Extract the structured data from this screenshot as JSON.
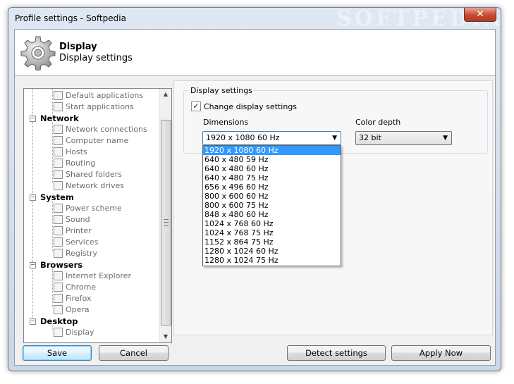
{
  "window": {
    "title": "Profile settings - Softpedia",
    "watermark": "SOFTPEDIA",
    "close_glyph": "✕"
  },
  "header": {
    "title": "Display",
    "subtitle": "Display settings",
    "icon": "gear-icon"
  },
  "tree": {
    "categories": [
      {
        "label": "",
        "children": [
          "Default applications",
          "Start applications"
        ]
      },
      {
        "label": "Network",
        "children": [
          "Network connections",
          "Computer name",
          "Hosts",
          "Routing",
          "Shared folders",
          "Network drives"
        ]
      },
      {
        "label": "System",
        "children": [
          "Power scheme",
          "Sound",
          "Printer",
          "Services",
          "Registry"
        ]
      },
      {
        "label": "Browsers",
        "children": [
          "Internet Explorer",
          "Chrome",
          "Firefox",
          "Opera"
        ]
      },
      {
        "label": "Desktop",
        "children": [
          "Display"
        ]
      }
    ]
  },
  "display_settings": {
    "group_label": "Display settings",
    "change_label": "Change display settings",
    "change_checked": true,
    "dimensions_label": "Dimensions",
    "dimensions_value": "1920 x 1080 60 Hz",
    "color_depth_label": "Color depth",
    "color_depth_value": "32 bit",
    "dimension_options": [
      "1920 x 1080 60 Hz",
      "640 x 480 59 Hz",
      "640 x 480 60 Hz",
      "640 x 480 75 Hz",
      "656 x 496 60 Hz",
      "800 x 600 60 Hz",
      "800 x 600 75 Hz",
      "848 x 480 60 Hz",
      "1024 x 768 60 Hz",
      "1024 x 768 75 Hz",
      "1152 x 864 75 Hz",
      "1280 x 1024 60 Hz",
      "1280 x 1024 75 Hz"
    ],
    "selected_option": "1920 x 1080 60 Hz"
  },
  "buttons": {
    "save": "Save",
    "cancel": "Cancel",
    "detect": "Detect settings",
    "apply": "Apply Now"
  },
  "colors": {
    "selection": "#3399ff",
    "close": "#c74a35"
  }
}
